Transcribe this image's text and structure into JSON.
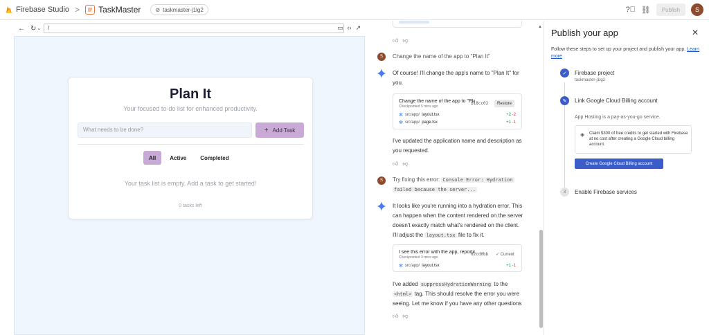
{
  "topbar": {
    "brand": "Firebase Studio",
    "separator": ">",
    "project_name": "TaskMaster",
    "workspace_chip": "taskmaster-j1lg2",
    "publish_label": "Publish",
    "avatar_initial": "S"
  },
  "preview": {
    "url": "/",
    "app": {
      "title": "Plan It",
      "subtitle": "Your focused to-do list for enhanced productivity.",
      "input_placeholder": "What needs to be done?",
      "add_button": "Add Task",
      "filters": [
        "All",
        "Active",
        "Completed"
      ],
      "active_filter": "All",
      "empty_message": "Your task list is empty. Add a task to get started!",
      "tasks_left": "0 tasks left"
    }
  },
  "chat": {
    "user_initial": "S",
    "msg1_user": "Change the name of the app to \"Plan It\"",
    "msg1_ai_line1": "Of course! I'll change the app's name to \"Plan It\" for",
    "msg1_ai_line2": "you.",
    "checkpoint1": {
      "title": "Change the name of the app to \"Pla",
      "subtitle": "Checkpointed 5 mins ago",
      "hash": "b18cc02",
      "action": "Restore",
      "files": [
        {
          "dir": "src/app/",
          "name": "layout.tsx",
          "added": "+2",
          "removed": "-2"
        },
        {
          "dir": "src/app/",
          "name": "page.tsx",
          "added": "+1",
          "removed": "-1"
        }
      ]
    },
    "msg1_ai_after_line1": "I've updated the application name and description as",
    "msg1_ai_after_line2": "you requested.",
    "msg2_user_prefix": "Try fixing this error:",
    "msg2_user_code_1": "Console Error: Hydration",
    "msg2_user_code_2": "failed because the server...",
    "msg2_ai_line1": "It looks like you're running into a hydration error. This",
    "msg2_ai_line2": "can happen when the content rendered on the server",
    "msg2_ai_line3": "doesn't exactly match what's rendered on the client.",
    "msg2_ai_line4_prefix": "I'll adjust the",
    "msg2_ai_line4_code": "layout.tsx",
    "msg2_ai_line4_suffix": "file to fix it.",
    "checkpoint2": {
      "title": "I see this error with the app, reportin",
      "subtitle": "Checkpointed 3 mins ago",
      "hash": "02cd0bb",
      "status": "Current",
      "files": [
        {
          "dir": "src/app/",
          "name": "layout.tsx",
          "added": "+1",
          "removed": "-1"
        }
      ]
    },
    "msg2_ai_after_line1_prefix": "I've added",
    "msg2_ai_after_line1_code": "suppressHydrationWarning",
    "msg2_ai_after_line1_suffix": "to the",
    "msg2_ai_after_line2_code": "<html>",
    "msg2_ai_after_line2_suffix": "tag. This should resolve the error you were",
    "msg2_ai_after_line3": "seeing. Let me know if you have any other questions"
  },
  "publish": {
    "title": "Publish your app",
    "description": "Follow these steps to set up your project and publish your app.",
    "learn_more": "Learn more",
    "steps": [
      {
        "label": "Firebase project",
        "sub": "taskmaster-j1lg2",
        "status": "done"
      },
      {
        "label": "Link Google Cloud Billing account",
        "sub": "App Hosting is a pay-as-you-go service.",
        "status": "active"
      },
      {
        "label": "Enable Firebase services",
        "number": "3",
        "status": "pending"
      }
    ],
    "info_text": "Claim $300 of free credits to get started with Firebase at no cost after creating a Google Cloud billing account.",
    "billing_button": "Create Google Cloud Billing account"
  },
  "colors": {
    "accent_purple": "#c9a9d6",
    "primary_blue": "#3b5dc9",
    "preview_bg": "#eff6fd",
    "avatar": "#8d4a2d"
  }
}
